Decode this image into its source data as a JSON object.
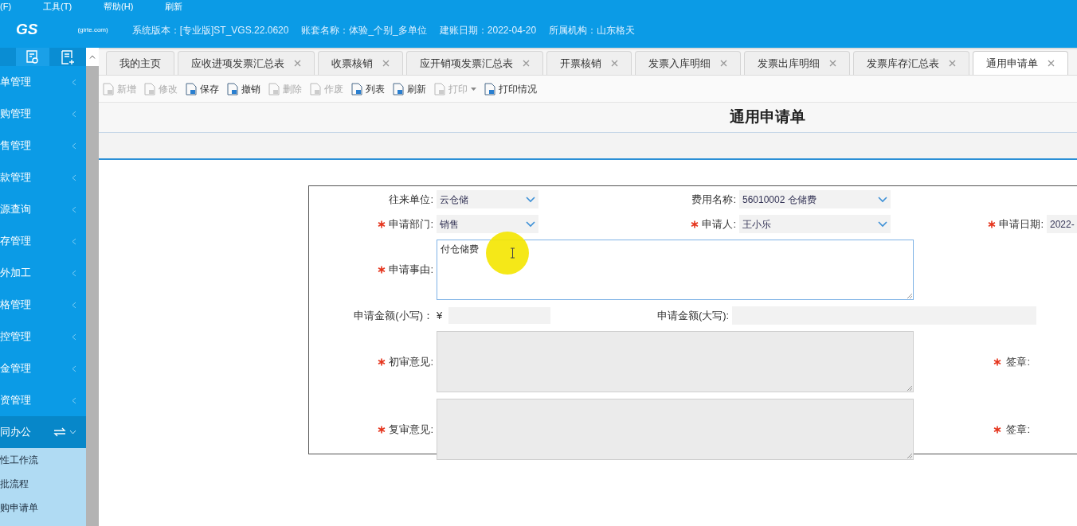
{
  "menu_bar": [
    "(F)",
    "工具(T)",
    "帮助(H)",
    "刷新"
  ],
  "header": {
    "logo": "GS",
    "logo_caption": "(girte.com)",
    "info": [
      "系统版本：[专业版]ST_VGS.22.0620",
      "账套名称：体验_个别_多单位",
      "建账日期：2022-04-20",
      "所属机构：山东格天"
    ]
  },
  "sidebar": {
    "items": [
      {
        "label": "单管理",
        "expanded": false
      },
      {
        "label": "购管理",
        "expanded": false
      },
      {
        "label": "售管理",
        "expanded": false
      },
      {
        "label": "款管理",
        "expanded": false
      },
      {
        "label": "源查询",
        "expanded": false
      },
      {
        "label": "存管理",
        "expanded": false
      },
      {
        "label": "外加工",
        "expanded": false
      },
      {
        "label": "格管理",
        "expanded": false
      },
      {
        "label": "控管理",
        "expanded": false
      },
      {
        "label": "金管理",
        "expanded": false
      },
      {
        "label": "资管理",
        "expanded": false
      },
      {
        "label": "同办公",
        "expanded": true,
        "children": [
          "性工作流",
          "批流程",
          "购申请单"
        ]
      }
    ]
  },
  "tabs": [
    {
      "label": "我的主页",
      "selected": false,
      "closable": false
    },
    {
      "label": "应收进项发票汇总表",
      "selected": false,
      "closable": true
    },
    {
      "label": "收票核销",
      "selected": false,
      "closable": true
    },
    {
      "label": "应开销项发票汇总表",
      "selected": false,
      "closable": true
    },
    {
      "label": "开票核销",
      "selected": false,
      "closable": true
    },
    {
      "label": "发票入库明细",
      "selected": false,
      "closable": true
    },
    {
      "label": "发票出库明细",
      "selected": false,
      "closable": true
    },
    {
      "label": "发票库存汇总表",
      "selected": false,
      "closable": true
    },
    {
      "label": "通用申请单",
      "selected": true,
      "closable": true
    }
  ],
  "toolbar": [
    {
      "label": "新增",
      "disabled": true
    },
    {
      "label": "修改",
      "disabled": true
    },
    {
      "label": "保存",
      "disabled": false
    },
    {
      "label": "撤销",
      "disabled": false
    },
    {
      "label": "删除",
      "disabled": true
    },
    {
      "label": "作废",
      "disabled": true
    },
    {
      "label": "列表",
      "disabled": false
    },
    {
      "label": "刷新",
      "disabled": false
    },
    {
      "label": "打印",
      "disabled": true,
      "dropdown": true
    },
    {
      "label": "打印情况",
      "disabled": false
    }
  ],
  "form": {
    "title": "通用申请单",
    "rows": [
      [
        {
          "label": "往来单位:",
          "required": false,
          "kind": "select",
          "value": "云仓储"
        },
        {
          "label": "费用名称:",
          "required": false,
          "kind": "select",
          "value": "56010002 仓储费"
        }
      ],
      [
        {
          "label": "申请部门:",
          "required": true,
          "kind": "select",
          "value": "销售"
        },
        {
          "label": "申请人:",
          "required": true,
          "kind": "select",
          "value": "王小乐"
        },
        {
          "label": "申请日期:",
          "required": true,
          "kind": "input",
          "value": "2022-"
        }
      ],
      [
        {
          "label": "申请事由:",
          "required": true,
          "kind": "textarea",
          "value": "付仓储费",
          "disabled": false
        }
      ],
      [
        {
          "label": "申请金额(小写)：",
          "required": false,
          "kind": "money",
          "prefix": "¥"
        },
        {
          "label": "申请金额(大写):",
          "required": false,
          "kind": "input"
        }
      ],
      [
        {
          "label": "初审意见:",
          "required": true,
          "kind": "textarea",
          "disabled": true
        },
        {
          "label": "签章:",
          "required": true,
          "kind": "sign"
        }
      ],
      [
        {
          "label": "复审意见:",
          "required": true,
          "kind": "textarea",
          "disabled": true
        },
        {
          "label": "签章:",
          "required": true,
          "kind": "sign"
        }
      ]
    ]
  }
}
